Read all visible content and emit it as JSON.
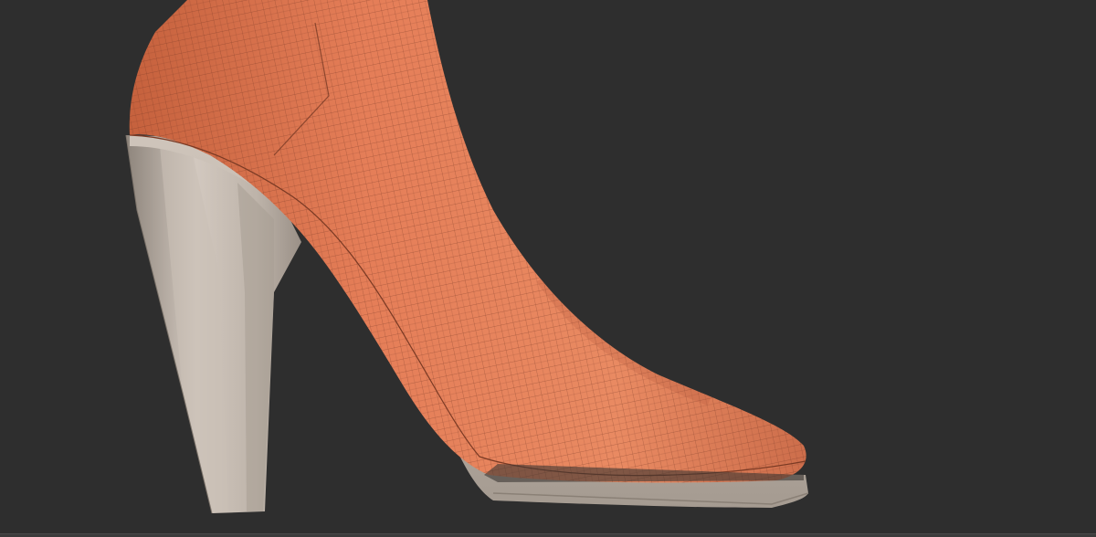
{
  "viewport": {
    "background": "#2e2e2e"
  },
  "model": {
    "leg_material_color": "#e07850",
    "leg_wire_color": "#5a2a1a",
    "shoe_material_color": "#b8aea4",
    "shoe_shadow_color": "#8a8076"
  }
}
